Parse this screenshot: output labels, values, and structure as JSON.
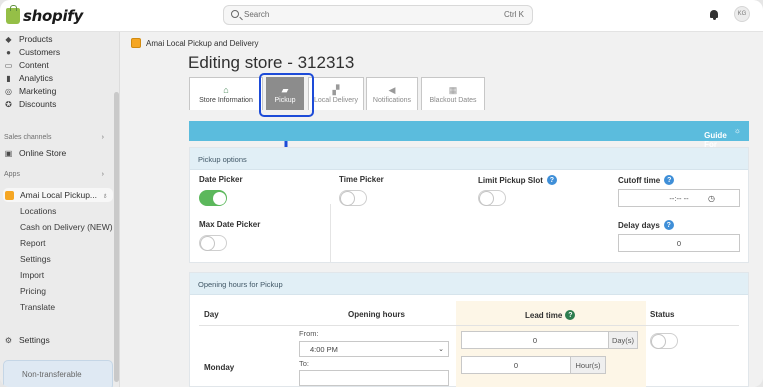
{
  "topbar": {
    "logo_text": "shopify",
    "search_placeholder": "Search",
    "search_shortcut": "Ctrl K",
    "avatar_initials": "KG"
  },
  "sidebar": {
    "items": [
      {
        "label": "Products",
        "icon": "tag-icon"
      },
      {
        "label": "Customers",
        "icon": "person-icon"
      },
      {
        "label": "Content",
        "icon": "content-icon"
      },
      {
        "label": "Analytics",
        "icon": "chart-icon"
      },
      {
        "label": "Marketing",
        "icon": "target-icon"
      },
      {
        "label": "Discounts",
        "icon": "discount-icon"
      }
    ],
    "sales_channels_label": "Sales channels",
    "online_store_label": "Online Store",
    "apps_label": "Apps",
    "app_name": "Amai Local Pickup...",
    "app_subitems": [
      "Locations",
      "Cash on Delivery (NEW)",
      "Report",
      "Settings",
      "Import",
      "Pricing",
      "Translate"
    ],
    "settings_label": "Settings",
    "bottom_note": "Non-transferable"
  },
  "main": {
    "breadcrumb": "Amai Local Pickup and Delivery",
    "title": "Editing store - 312313",
    "tabs": [
      {
        "label": "Store Information",
        "icon": "house-icon"
      },
      {
        "label": "Pickup",
        "icon": "bag-icon"
      },
      {
        "label": "Local Delivery",
        "icon": "truck-icon"
      },
      {
        "label": "Notifications",
        "icon": "megaphone-icon"
      },
      {
        "label": "Blackout Dates",
        "icon": "calendar-icon"
      }
    ],
    "selected_tab": "Pickup",
    "guide_banner": "Guide For Pickup Section",
    "pickup_options": {
      "heading": "Pickup options",
      "date_picker_label": "Date Picker",
      "date_picker_on": true,
      "time_picker_label": "Time Picker",
      "time_picker_on": false,
      "limit_slot_label": "Limit Pickup Slot",
      "limit_slot_on": false,
      "cutoff_label": "Cutoff time",
      "cutoff_value": "--:-- --",
      "max_date_label": "Max Date Picker",
      "max_date_on": false,
      "delay_days_label": "Delay days",
      "delay_days_value": "0"
    },
    "opening_hours": {
      "heading": "Opening hours for Pickup",
      "col_day": "Day",
      "col_hours": "Opening hours",
      "col_lead": "Lead time",
      "col_status": "Status",
      "row_day": "Monday",
      "from_label": "From:",
      "from_value": "4:00 PM",
      "to_label": "To:",
      "lead_days_value": "0",
      "lead_days_unit": "Day(s)",
      "lead_hours_value": "0",
      "lead_hours_unit": "Hour(s)"
    }
  },
  "colors": {
    "accent_banner": "#5bbcdd",
    "toggle_on": "#5cb85c",
    "highlight": "#1d4bd8"
  }
}
